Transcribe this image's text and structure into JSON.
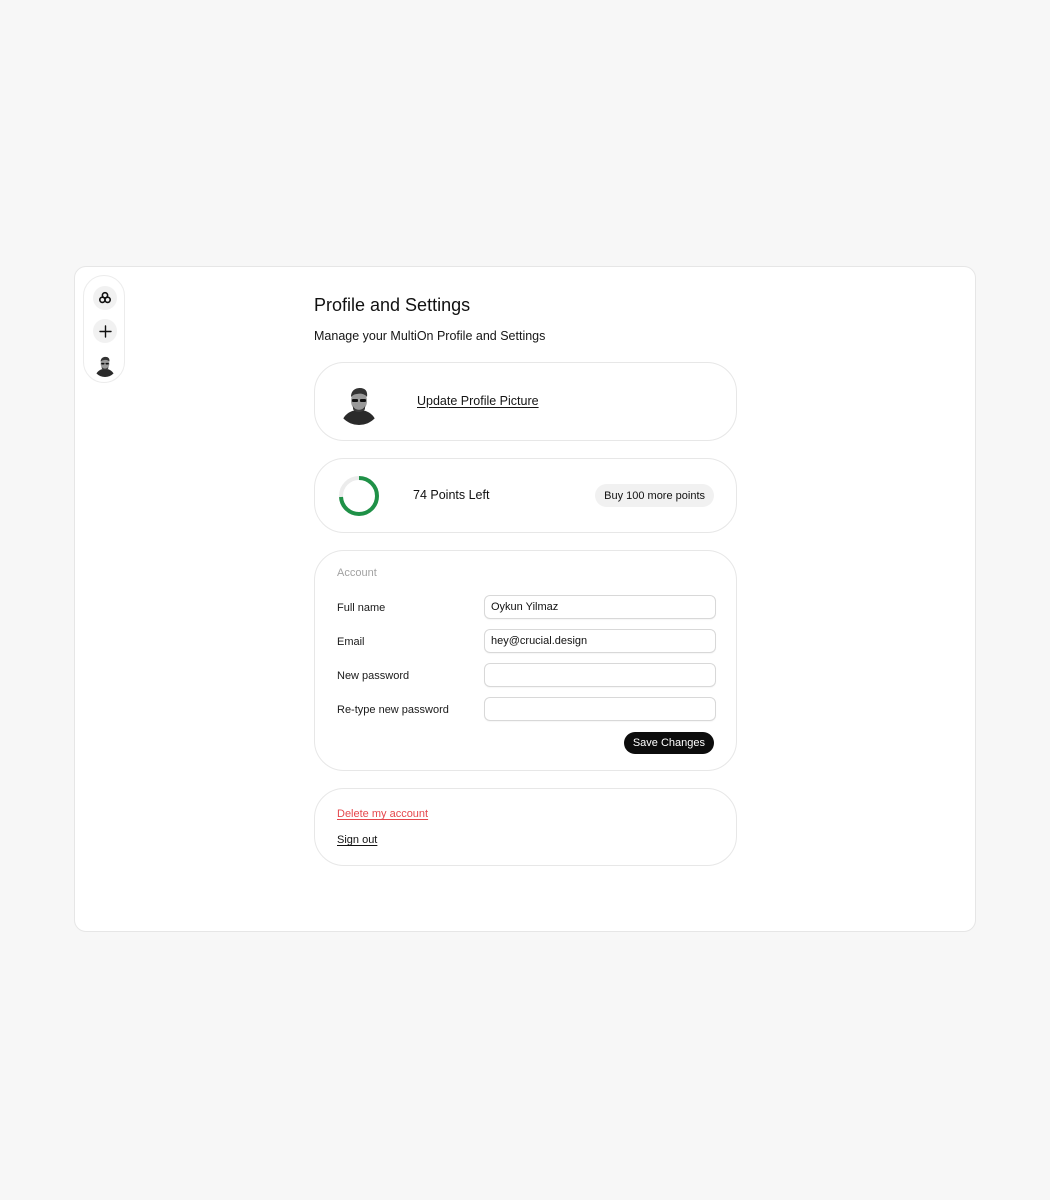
{
  "rail": {
    "icons": [
      "multion-logo-icon",
      "plus-icon",
      "user-avatar"
    ]
  },
  "page": {
    "title": "Profile and Settings",
    "subtitle": "Manage your MultiOn Profile and Settings"
  },
  "profile": {
    "update_picture_label": "Update Profile Picture"
  },
  "points": {
    "label": "74 Points Left",
    "remaining_fraction": 0.74,
    "ring_color": "#1f9147",
    "buy_label": "Buy 100 more points"
  },
  "account": {
    "section_label": "Account",
    "fields": [
      {
        "label": "Full name",
        "value": "Oykun Yilmaz"
      },
      {
        "label": "Email",
        "value": "hey@crucial.design"
      },
      {
        "label": "New password",
        "value": ""
      },
      {
        "label": "Re-type new password",
        "value": ""
      }
    ],
    "save_label": "Save Changes"
  },
  "danger": {
    "delete_label": "Delete my account",
    "delete_color": "#e5484d",
    "signout_label": "Sign out"
  }
}
